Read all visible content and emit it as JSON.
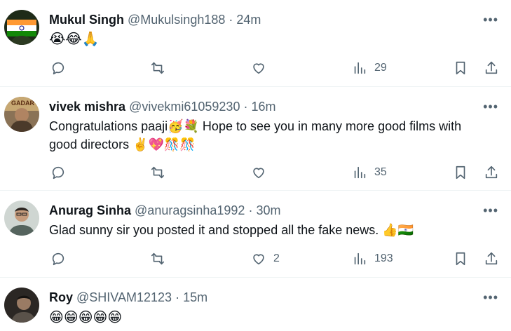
{
  "tweets": [
    {
      "name": "Mukul Singh",
      "handle": "@Mukulsingh188",
      "dot": "·",
      "time": "24m",
      "text": "😭😂🙏",
      "more": "•••",
      "views": "29",
      "likes": "",
      "avatar_color": "#1e2b18"
    },
    {
      "name": "vivek mishra",
      "handle": "@vivekmi61059230",
      "dot": "·",
      "time": "16m",
      "text_line1": "Congratulations paaji🥳💐 Hope to see you in many more good films with",
      "text_line2": "good directors ✌️💖🎊🎊",
      "more": "•••",
      "views": "35",
      "likes": "",
      "avatar_color": "#5a4636"
    },
    {
      "name": "Anurag Sinha",
      "handle": "@anuragsinha1992",
      "dot": "·",
      "time": "30m",
      "text": "Glad sunny sir you posted it and stopped all the fake news. 👍🇮🇳",
      "more": "•••",
      "views": "193",
      "likes": "2",
      "avatar_color": "#7b8a86"
    },
    {
      "name": "Roy",
      "handle": "@SHIVAM12123",
      "dot": "·",
      "time": "15m",
      "text": "😁😁😁😁😁",
      "more": "•••",
      "avatar_color": "#3a3530"
    }
  ]
}
